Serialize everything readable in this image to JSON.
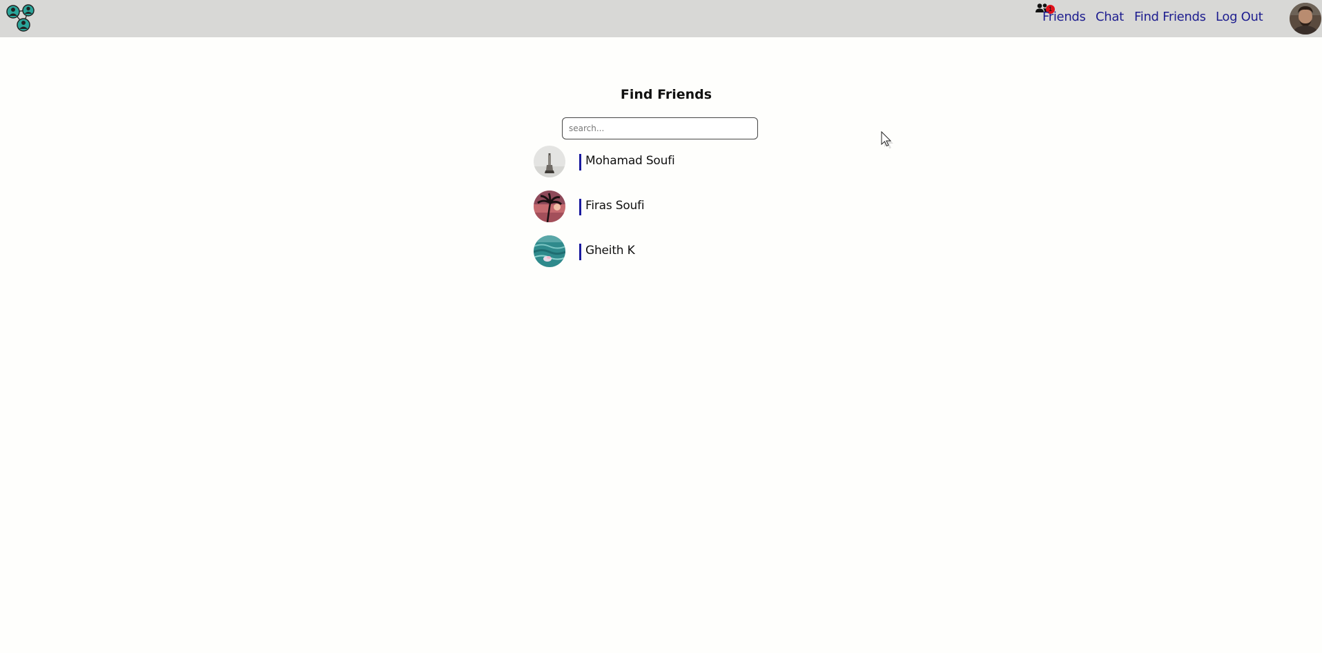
{
  "nav": {
    "logo_icon": "network-people-logo",
    "friend_requests": {
      "icon": "friends-group-icon",
      "count": "1"
    },
    "links": {
      "friends": "Friends",
      "chat": "Chat",
      "find_friends": "Find Friends",
      "log_out": "Log Out"
    },
    "profile_avatar": "user-profile-photo"
  },
  "main": {
    "title": "Find Friends",
    "search": {
      "placeholder": "search...",
      "value": ""
    },
    "users": [
      {
        "name": "Mohamad Soufi",
        "avatar": "lighthouse-photo"
      },
      {
        "name": "Firas Soufi",
        "avatar": "palm-tree-sunset-photo"
      },
      {
        "name": "Gheith K",
        "avatar": "ocean-waves-photo"
      }
    ]
  },
  "colors": {
    "navbar_bg": "#d8d8d6",
    "page_bg": "#fefefc",
    "link": "#1d1d8f",
    "accent_bar": "#1a1a9e",
    "badge": "#e0101a"
  }
}
